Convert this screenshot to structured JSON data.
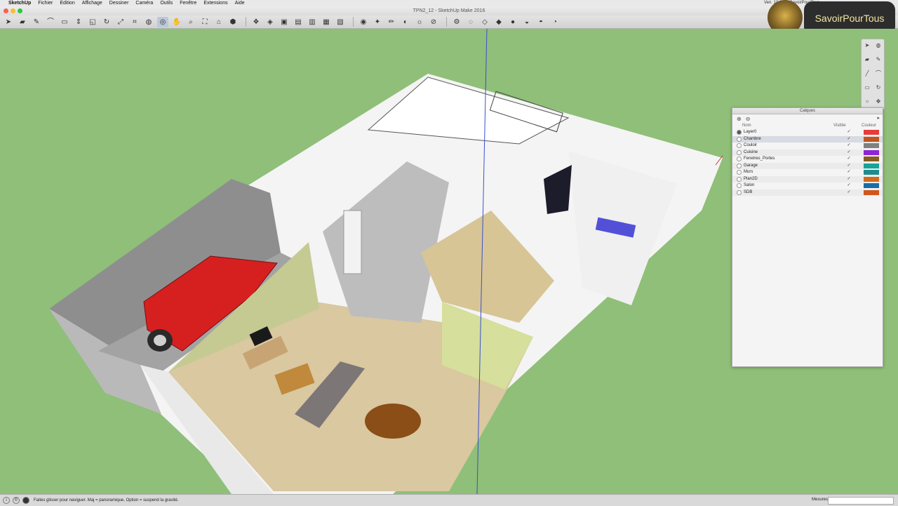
{
  "menubar": {
    "app": "SketchUp",
    "items": [
      "Fichier",
      "Edition",
      "Affichage",
      "Dessiner",
      "Caméra",
      "Outils",
      "Fenêtre",
      "Extensions",
      "Aide"
    ],
    "tray": [
      "Ven. 10:08",
      "SavoirPourTous"
    ]
  },
  "window": {
    "title": "TPN2_12 - SketchUp Make 2016"
  },
  "toolbar": {
    "icons": [
      "select-icon",
      "eraser-icon",
      "pencil-icon",
      "arc-icon",
      "rectangle-icon",
      "push-pull-icon",
      "offset-icon",
      "rotate-icon",
      "scale-icon",
      "tape-measure-icon",
      "paint-bucket-icon",
      "orbit-icon",
      "pan-icon",
      "zoom-icon",
      "zoom-extents-icon",
      "warehouse-icon",
      "extension-icon",
      "component-icon",
      "iso-view-icon",
      "top-view-icon",
      "front-view-icon",
      "right-view-icon",
      "back-view-icon",
      "left-view-icon",
      "geo-icon",
      "sandbox-icon",
      "sketch-icon",
      "style-icon",
      "shadow-icon",
      "section-icon",
      "settings-icon",
      "xray-icon",
      "wireframe-icon",
      "hidden-line-icon",
      "shaded-icon",
      "textured-icon",
      "monochrome-icon",
      "display-icon"
    ],
    "selected_index": 11
  },
  "brand": {
    "name": "SavoirPourTous"
  },
  "right_tools": {
    "icons": [
      "select-icon",
      "paint-icon",
      "eraser-icon",
      "pencil-icon",
      "line-icon",
      "arc-icon",
      "rect-icon",
      "rotate-icon",
      "circle-icon",
      "move-icon"
    ]
  },
  "layers": {
    "title": "Calques",
    "add_icon": "⊕",
    "remove_icon": "⊖",
    "detail_icon": "▸",
    "columns": {
      "name": "Nom",
      "visible": "Visible",
      "color": "Couleur"
    },
    "check": "✓",
    "items": [
      {
        "name": "Layer0",
        "active": true,
        "color": "#e83a3a"
      },
      {
        "name": "Chambre",
        "active": false,
        "color": "#c2541c"
      },
      {
        "name": "Couloir",
        "active": false,
        "color": "#808080"
      },
      {
        "name": "Cuisine",
        "active": false,
        "color": "#8e23d8"
      },
      {
        "name": "Fenetres_Portes",
        "active": false,
        "color": "#8a5a23"
      },
      {
        "name": "Garage",
        "active": false,
        "color": "#17a39a"
      },
      {
        "name": "Murs",
        "active": false,
        "color": "#1f8c8c"
      },
      {
        "name": "Plan2D",
        "active": false,
        "color": "#d26a1c"
      },
      {
        "name": "Salon",
        "active": false,
        "color": "#1a6ea8"
      },
      {
        "name": "SDB",
        "active": false,
        "color": "#d2561c"
      }
    ],
    "selected_index": 1
  },
  "status": {
    "message": "Faites glisser pour naviguer. Maj = panoramique, Option = suspend la gravité.",
    "measure_label": "Mesures",
    "measure_value": ""
  },
  "colors": {
    "ground": "#8fbf78",
    "sky_fill": "#8fbf78",
    "floor_tile": "#d8c8a0",
    "wall": "#f2f2f2",
    "garage_wall": "#9a9a9a",
    "car": "#d62020"
  }
}
